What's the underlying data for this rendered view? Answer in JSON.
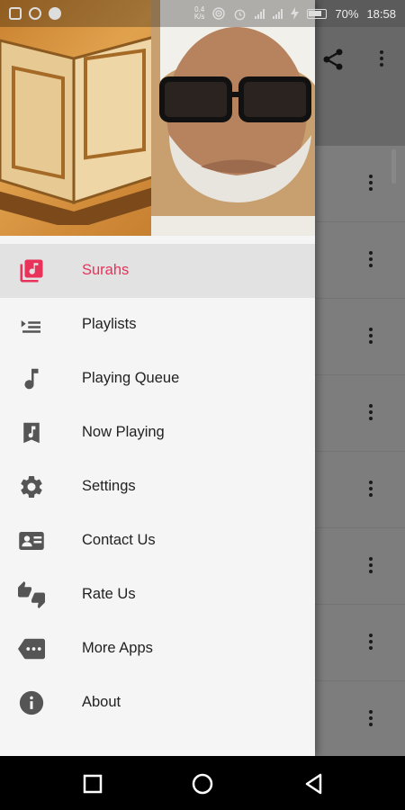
{
  "status_bar": {
    "network_speed_value": "0.4",
    "network_speed_unit": "K/s",
    "battery_percent": "70%",
    "time": "18:58"
  },
  "colors": {
    "accent": "#e8325a",
    "drawer_background": "#f5f5f5",
    "active_row": "#e2e2e2",
    "icon_grey": "#555555"
  },
  "toolbar": {
    "share_icon": "share-icon",
    "more_icon": "more-vert-icon"
  },
  "drawer": {
    "header_images": [
      "quran-book-image",
      "sheikh-portrait-image"
    ],
    "menu": [
      {
        "label": "Surahs",
        "icon": "music-library-icon",
        "active": true
      },
      {
        "label": "Playlists",
        "icon": "playlist-icon",
        "active": false
      },
      {
        "label": "Playing Queue",
        "icon": "music-note-icon",
        "active": false
      },
      {
        "label": "Now Playing",
        "icon": "music-bookmark-icon",
        "active": false
      },
      {
        "label": "Settings",
        "icon": "gear-icon",
        "active": false
      },
      {
        "label": "Contact Us",
        "icon": "contact-card-icon",
        "active": false
      },
      {
        "label": "Rate Us",
        "icon": "thumbs-up-down-icon",
        "active": false
      },
      {
        "label": "More Apps",
        "icon": "more-apps-tag-icon",
        "active": false
      },
      {
        "label": "About",
        "icon": "info-icon",
        "active": false
      }
    ]
  },
  "nav_bar": {
    "buttons": [
      "recent-apps-icon",
      "home-icon",
      "back-icon"
    ]
  }
}
